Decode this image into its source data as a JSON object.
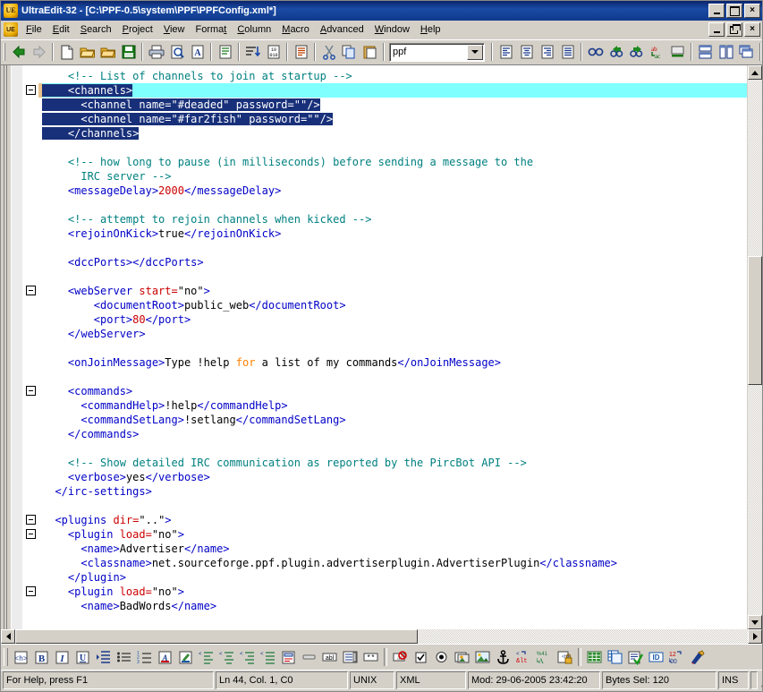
{
  "window": {
    "title": "UltraEdit-32 - [C:\\PPF-0.5\\system\\PPF\\PPFConfig.xml*]",
    "app_icon": "ue-icon",
    "minimize_label": "_",
    "maximize_label": "□",
    "close_label": "×"
  },
  "menubar": {
    "items": [
      {
        "label": "File",
        "accel": "F"
      },
      {
        "label": "Edit",
        "accel": "E"
      },
      {
        "label": "Search",
        "accel": "S"
      },
      {
        "label": "Project",
        "accel": "P"
      },
      {
        "label": "View",
        "accel": "V"
      },
      {
        "label": "Format",
        "accel": "t"
      },
      {
        "label": "Column",
        "accel": "C"
      },
      {
        "label": "Macro",
        "accel": "M"
      },
      {
        "label": "Advanced",
        "accel": "A"
      },
      {
        "label": "Window",
        "accel": "W"
      },
      {
        "label": "Help",
        "accel": "H"
      }
    ],
    "mdi_minimize": "_",
    "mdi_restore": "❐",
    "mdi_close": "×"
  },
  "toolbar": {
    "groups": [
      {
        "icons": [
          "back-arrow-icon",
          "forward-arrow-icon"
        ]
      },
      {
        "icons": [
          "new-file-icon",
          "open-file-icon",
          "open-folder-icon",
          "save-icon"
        ]
      },
      {
        "icons": [
          "print-icon",
          "print-preview-icon",
          "find-replace-font-icon"
        ]
      },
      {
        "icons": [
          "word-wrap-icon"
        ]
      },
      {
        "icons": [
          "sort-lines-icon",
          "hex-edit-icon"
        ]
      },
      {
        "icons": [
          "spell-check-icon"
        ]
      },
      {
        "icons": [
          "cut-icon",
          "copy-icon",
          "paste-icon"
        ]
      }
    ],
    "search_combo": {
      "value": "ppf",
      "placeholder": ""
    },
    "groups2": [
      {
        "icons": [
          "align-left-icon",
          "align-center-icon",
          "align-right-icon",
          "justify-icon"
        ]
      },
      {
        "icons": [
          "find-icon",
          "find-prev-icon",
          "find-next-icon",
          "replace-icon",
          "find-in-files-icon"
        ]
      },
      {
        "icons": [
          "tile-horizontal-icon",
          "tile-vertical-icon",
          "cascade-icon"
        ]
      }
    ]
  },
  "bottom_toolbar": {
    "groups": [
      {
        "icons": [
          "html-tag-icon",
          "bold-icon",
          "italic-icon",
          "underline-icon"
        ]
      },
      {
        "icons": [
          "indent-icon",
          "bullet-list-icon",
          "numbered-list-icon"
        ]
      },
      {
        "icons": [
          "font-color-icon",
          "highlight-color-icon"
        ]
      },
      {
        "icons": [
          "para-align-left-icon",
          "para-align-center-icon",
          "para-align-right-icon",
          "para-justify-icon"
        ]
      },
      {
        "icons": [
          "insert-form-icon",
          "horizontal-rule-icon",
          "text-field-icon",
          "dropdown-field-icon",
          "password-field-icon"
        ]
      },
      {
        "icons": [
          "no-entry-icon",
          "checkbox-field-icon",
          "radio-field-icon",
          "insert-image-icon",
          "image-properties-icon",
          "anchor-icon",
          "special-char-icon",
          "font-size-icon",
          "lock-icon"
        ]
      },
      {
        "icons": [
          "table-icon",
          "table-copy-icon",
          "validate-icon",
          "id-tag-icon",
          "number-format-icon",
          "tidy-icon"
        ]
      }
    ]
  },
  "statusbar": {
    "help": "For Help, press F1",
    "position": "Ln 44, Col. 1, C0",
    "eol": "UNIX",
    "language": "XML",
    "modified": "Mod: 29-06-2005 23:42:20",
    "bytes_selected": "Bytes Sel: 120",
    "insert_mode": "INS"
  },
  "editor": {
    "colors": {
      "comment": "#008080",
      "tag": "#0000c8",
      "attribute": "#cc0000",
      "number": "#cc0000",
      "text": "#000000",
      "keyword": "#ff8000",
      "selection_bg": "#18307a",
      "selection_fg": "#ffffff",
      "current_line_bg": "#80ffff",
      "background": "#ffffff",
      "bookmark_strip": "#e8c48c"
    },
    "lines": [
      {
        "fold": false,
        "state": "normal",
        "tokens": [
          {
            "t": "com",
            "s": "    <!-- List of channels to join at startup -->"
          }
        ]
      },
      {
        "fold": true,
        "state": "current",
        "bookmark": true,
        "tokens": [
          {
            "t": "tag",
            "s": "    <channels>",
            "sel": true
          }
        ]
      },
      {
        "fold": false,
        "state": "selected",
        "tokens": [
          {
            "t": "tag",
            "s": "      <channel name=\"#deaded\" password=\"\"/>",
            "sel": true
          }
        ]
      },
      {
        "fold": false,
        "state": "selected",
        "tokens": [
          {
            "t": "tag",
            "s": "      <channel name=\"#far2fish\" password=\"\"/>",
            "sel": true
          }
        ]
      },
      {
        "fold": false,
        "state": "selected",
        "tokens": [
          {
            "t": "tag",
            "s": "    </channels>",
            "sel": true
          }
        ]
      },
      {
        "fold": false,
        "state": "normal",
        "tokens": [
          {
            "t": "txt",
            "s": ""
          }
        ]
      },
      {
        "fold": false,
        "state": "normal",
        "tokens": [
          {
            "t": "com",
            "s": "    <!-- how long to pause (in milliseconds) before sending a message to the"
          }
        ]
      },
      {
        "fold": false,
        "state": "normal",
        "tokens": [
          {
            "t": "com",
            "s": "      IRC server -->"
          }
        ]
      },
      {
        "fold": false,
        "state": "normal",
        "tokens": [
          {
            "t": "tag",
            "s": "    <messageDelay>"
          },
          {
            "t": "num",
            "s": "2000"
          },
          {
            "t": "tag",
            "s": "</messageDelay>"
          }
        ]
      },
      {
        "fold": false,
        "state": "normal",
        "tokens": [
          {
            "t": "txt",
            "s": ""
          }
        ]
      },
      {
        "fold": false,
        "state": "normal",
        "tokens": [
          {
            "t": "com",
            "s": "    <!-- attempt to rejoin channels when kicked -->"
          }
        ]
      },
      {
        "fold": false,
        "state": "normal",
        "tokens": [
          {
            "t": "tag",
            "s": "    <rejoinOnKick>"
          },
          {
            "t": "txt",
            "s": "true"
          },
          {
            "t": "tag",
            "s": "</rejoinOnKick>"
          }
        ]
      },
      {
        "fold": false,
        "state": "normal",
        "tokens": [
          {
            "t": "txt",
            "s": ""
          }
        ]
      },
      {
        "fold": false,
        "state": "normal",
        "tokens": [
          {
            "t": "tag",
            "s": "    <dccPorts></dccPorts>"
          }
        ]
      },
      {
        "fold": false,
        "state": "normal",
        "tokens": [
          {
            "t": "txt",
            "s": ""
          }
        ]
      },
      {
        "fold": true,
        "state": "normal",
        "tokens": [
          {
            "t": "tag",
            "s": "    <webServer "
          },
          {
            "t": "attr",
            "s": "start="
          },
          {
            "t": "str",
            "s": "\"no\""
          },
          {
            "t": "tag",
            "s": ">"
          }
        ]
      },
      {
        "fold": false,
        "state": "normal",
        "tokens": [
          {
            "t": "tag",
            "s": "        <documentRoot>"
          },
          {
            "t": "txt",
            "s": "public_web"
          },
          {
            "t": "tag",
            "s": "</documentRoot>"
          }
        ]
      },
      {
        "fold": false,
        "state": "normal",
        "tokens": [
          {
            "t": "tag",
            "s": "        <port>"
          },
          {
            "t": "num",
            "s": "80"
          },
          {
            "t": "tag",
            "s": "</port>"
          }
        ]
      },
      {
        "fold": false,
        "state": "normal",
        "tokens": [
          {
            "t": "tag",
            "s": "    </webServer>"
          }
        ]
      },
      {
        "fold": false,
        "state": "normal",
        "tokens": [
          {
            "t": "txt",
            "s": ""
          }
        ]
      },
      {
        "fold": false,
        "state": "normal",
        "tokens": [
          {
            "t": "tag",
            "s": "    <onJoinMessage>"
          },
          {
            "t": "txt",
            "s": "Type !help "
          },
          {
            "t": "kw",
            "s": "for"
          },
          {
            "t": "txt",
            "s": " a list of my commands"
          },
          {
            "t": "tag",
            "s": "</onJoinMessage>"
          }
        ]
      },
      {
        "fold": false,
        "state": "normal",
        "tokens": [
          {
            "t": "txt",
            "s": ""
          }
        ]
      },
      {
        "fold": true,
        "state": "normal",
        "tokens": [
          {
            "t": "tag",
            "s": "    <commands>"
          }
        ]
      },
      {
        "fold": false,
        "state": "normal",
        "tokens": [
          {
            "t": "tag",
            "s": "      <commandHelp>"
          },
          {
            "t": "txt",
            "s": "!help"
          },
          {
            "t": "tag",
            "s": "</commandHelp>"
          }
        ]
      },
      {
        "fold": false,
        "state": "normal",
        "tokens": [
          {
            "t": "tag",
            "s": "      <commandSetLang>"
          },
          {
            "t": "txt",
            "s": "!setlang"
          },
          {
            "t": "tag",
            "s": "</commandSetLang>"
          }
        ]
      },
      {
        "fold": false,
        "state": "normal",
        "tokens": [
          {
            "t": "tag",
            "s": "    </commands>"
          }
        ]
      },
      {
        "fold": false,
        "state": "normal",
        "tokens": [
          {
            "t": "txt",
            "s": ""
          }
        ]
      },
      {
        "fold": false,
        "state": "normal",
        "tokens": [
          {
            "t": "com",
            "s": "    <!-- Show detailed IRC communication as reported by the PircBot API -->"
          }
        ]
      },
      {
        "fold": false,
        "state": "normal",
        "tokens": [
          {
            "t": "tag",
            "s": "    <verbose>"
          },
          {
            "t": "txt",
            "s": "yes"
          },
          {
            "t": "tag",
            "s": "</verbose>"
          }
        ]
      },
      {
        "fold": false,
        "state": "normal",
        "tokens": [
          {
            "t": "tag",
            "s": "  </irc-settings>"
          }
        ]
      },
      {
        "fold": false,
        "state": "normal",
        "tokens": [
          {
            "t": "txt",
            "s": ""
          }
        ]
      },
      {
        "fold": true,
        "state": "normal",
        "tokens": [
          {
            "t": "tag",
            "s": "  <plugins "
          },
          {
            "t": "attr",
            "s": "dir="
          },
          {
            "t": "str",
            "s": "\"..\""
          },
          {
            "t": "tag",
            "s": ">"
          }
        ]
      },
      {
        "fold": true,
        "state": "normal",
        "tokens": [
          {
            "t": "tag",
            "s": "    <plugin "
          },
          {
            "t": "attr",
            "s": "load="
          },
          {
            "t": "str",
            "s": "\"no\""
          },
          {
            "t": "tag",
            "s": ">"
          }
        ]
      },
      {
        "fold": false,
        "state": "normal",
        "tokens": [
          {
            "t": "tag",
            "s": "      <name>"
          },
          {
            "t": "txt",
            "s": "Advertiser"
          },
          {
            "t": "tag",
            "s": "</name>"
          }
        ]
      },
      {
        "fold": false,
        "state": "normal",
        "tokens": [
          {
            "t": "tag",
            "s": "      <classname>"
          },
          {
            "t": "txt",
            "s": "net.sourceforge.ppf.plugin.advertiserplugin.AdvertiserPlugin"
          },
          {
            "t": "tag",
            "s": "</classname>"
          }
        ]
      },
      {
        "fold": false,
        "state": "normal",
        "tokens": [
          {
            "t": "tag",
            "s": "    </plugin>"
          }
        ]
      },
      {
        "fold": true,
        "state": "normal",
        "tokens": [
          {
            "t": "tag",
            "s": "    <plugin "
          },
          {
            "t": "attr",
            "s": "load="
          },
          {
            "t": "str",
            "s": "\"no\""
          },
          {
            "t": "tag",
            "s": ">"
          }
        ]
      },
      {
        "fold": false,
        "state": "normal",
        "tokens": [
          {
            "t": "tag",
            "s": "      <name>"
          },
          {
            "t": "txt",
            "s": "BadWords"
          },
          {
            "t": "tag",
            "s": "</name>"
          }
        ]
      }
    ]
  }
}
